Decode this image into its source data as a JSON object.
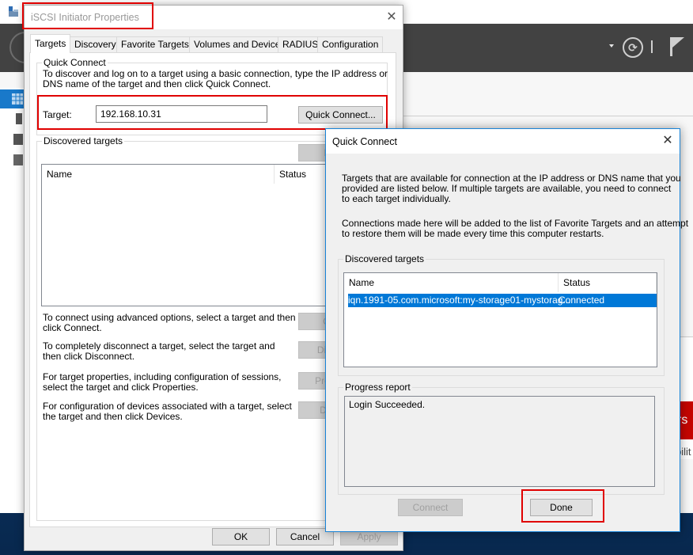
{
  "background_app": {
    "icons": {
      "app": "server-manager-icon",
      "back": "back-arrow-icon",
      "dropdown": "caret-down-icon",
      "refresh": "refresh-icon",
      "flag": "notifications-flag-icon",
      "nav": [
        "dashboard-icon",
        "local-server-icon",
        "all-servers-icon",
        "file-storage-icon"
      ]
    },
    "red_tile_fragment": "rs",
    "side_text_fragment": "bilit",
    "colors": {
      "header": "#424242",
      "nav_selected": "#1979ca",
      "tile": "#c50500"
    }
  },
  "iscsi_dialog": {
    "title": "iSCSI Initiator Properties",
    "close_glyph": "✕",
    "tabs": [
      {
        "label": "Targets",
        "active": true
      },
      {
        "label": "Discovery",
        "active": false
      },
      {
        "label": "Favorite Targets",
        "active": false
      },
      {
        "label": "Volumes and Devices",
        "active": false
      },
      {
        "label": "RADIUS",
        "active": false
      },
      {
        "label": "Configuration",
        "active": false
      }
    ],
    "quick_connect": {
      "group_label": "Quick Connect",
      "description_line1": "To discover and log on to a target using a basic connection, type the IP address or",
      "description_line2": "DNS name of the target and then click Quick Connect.",
      "target_label": "Target:",
      "target_value": "192.168.10.31",
      "button": "Quick Connect..."
    },
    "discovered_targets": {
      "group_label": "Discovered targets",
      "refresh_button": "Refresh",
      "columns": [
        "Name",
        "Status"
      ],
      "rows": []
    },
    "actions": [
      {
        "line1": "To connect using advanced options, select a target and then",
        "line2": "click Connect.",
        "button": "Connect"
      },
      {
        "line1": "To completely disconnect a target, select the target and",
        "line2": "then click Disconnect.",
        "button": "Disconnect"
      },
      {
        "line1": "For target properties, including configuration of sessions,",
        "line2": "select the target and click Properties.",
        "button": "Properties..."
      },
      {
        "line1": "For configuration of devices associated with a target, select",
        "line2": "the target and then click Devices.",
        "button": "Devices..."
      }
    ],
    "footer": {
      "ok": "OK",
      "cancel": "Cancel",
      "apply": "Apply"
    }
  },
  "quick_connect_dialog": {
    "title": "Quick Connect",
    "close_glyph": "✕",
    "intro_line1": "Targets that are available for connection at the IP address or DNS name that you",
    "intro_line2": "provided are listed below.  If multiple targets are available, you need to connect",
    "intro_line3": "to each target individually.",
    "note_line1": "Connections made here will be added to the list of Favorite Targets and an attempt",
    "note_line2": "to restore them will be made every time this computer restarts.",
    "discovered_targets": {
      "group_label": "Discovered targets",
      "columns": [
        "Name",
        "Status"
      ],
      "rows": [
        {
          "name": "iqn.1991-05.com.microsoft:my-storage01-mystorag...",
          "status": "Connected",
          "selected": true
        }
      ]
    },
    "progress_report": {
      "group_label": "Progress report",
      "text": "Login Succeeded."
    },
    "buttons": {
      "connect": "Connect",
      "done": "Done"
    },
    "colors": {
      "selection": "#0078d7",
      "border": "#1883d7",
      "highlight": "#e00000"
    }
  }
}
